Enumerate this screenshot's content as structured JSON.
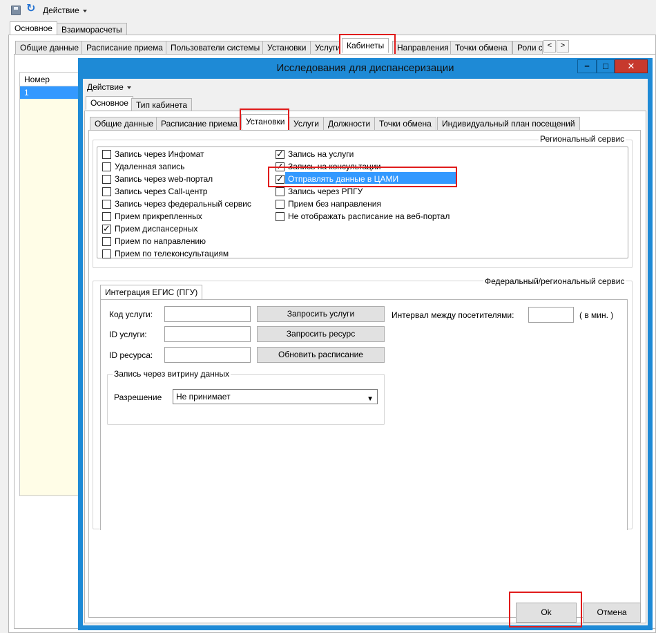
{
  "toolbar": {
    "menu_label": "Действие"
  },
  "main_tabs": [
    "Основное",
    "Взаиморасчеты"
  ],
  "sub_tabs": [
    "Общие данные",
    "Расписание приема",
    "Пользователи системы",
    "Установки",
    "Услуги",
    "Кабинеты",
    "Направления",
    "Точки обмена",
    "Роли с"
  ],
  "nav": {
    "prev": "<",
    "next": ">"
  },
  "grid": {
    "column_header": "Номер",
    "rows": [
      "1"
    ]
  },
  "dialog": {
    "title": "Исследования для диспансеризации",
    "window_buttons": {
      "minimize": "−",
      "maximize": "□",
      "close": "✕"
    },
    "menu_label": "Действие",
    "main_tabs": [
      "Основное",
      "Тип кабинета"
    ],
    "sub_tabs": [
      "Общие данные",
      "Расписание приема",
      "Установки",
      "Услуги",
      "Должности",
      "Точки обмена",
      "Индивидуальный план посещений"
    ],
    "regional": {
      "title": "Региональный сервис",
      "left_checks": [
        {
          "label": "Запись через Инфомат",
          "checked": false
        },
        {
          "label": "Удаленная запись",
          "checked": false
        },
        {
          "label": "Запись через web-портал",
          "checked": false
        },
        {
          "label": "Запись через Call-центр",
          "checked": false
        },
        {
          "label": "Запись через федеральный сервис",
          "checked": false
        },
        {
          "label": "Прием прикрепленных",
          "checked": false
        },
        {
          "label": "Прием диспансерных",
          "checked": true
        },
        {
          "label": "Прием по направлению",
          "checked": false
        },
        {
          "label": "Прием по телеконсультациям",
          "checked": false
        }
      ],
      "right_checks": [
        {
          "label": "Запись на услуги",
          "checked": true
        },
        {
          "label": "Запись на консультации",
          "checked": true
        },
        {
          "label": "Отправлять данные в ЦАМИ",
          "checked": true
        },
        {
          "label": "Запись через РПГУ",
          "checked": false
        },
        {
          "label": "Прием без направления",
          "checked": false
        },
        {
          "label": "Не отображать расписание на веб-портал",
          "checked": false
        }
      ]
    },
    "federal": {
      "title": "Федеральный/региональный сервис",
      "tab": "Интеграция ЕГИС (ПГУ)",
      "service_code_label": "Код услуги:",
      "service_id_label": "ID услуги:",
      "resource_id_label": "ID ресурса:",
      "request_services": "Запросить услуги",
      "request_resource": "Запросить ресурс",
      "update_schedule": "Обновить расписание",
      "interval_label": "Интервал между посетителями:",
      "interval_unit": "( в мин. )",
      "showcase": {
        "title": "Запись через витрину данных",
        "permission_label": "Разрешение",
        "permission_value": "Не принимает"
      }
    },
    "ok": "Ok",
    "cancel": "Отмена"
  }
}
